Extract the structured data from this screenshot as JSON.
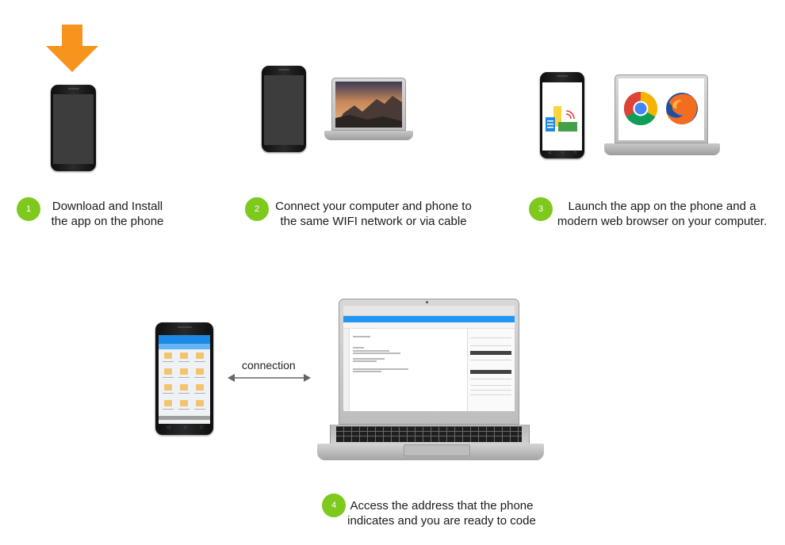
{
  "steps": [
    {
      "number": "1",
      "line1": "Download and Install",
      "line2": "the app on the phone"
    },
    {
      "number": "2",
      "line1": "Connect your computer and phone to",
      "line2": "the same WIFI network or via cable"
    },
    {
      "number": "3",
      "line1": "Launch the app on the phone and a",
      "line2": "modern web browser on your computer."
    },
    {
      "number": "4",
      "line1": "Access the address that the phone",
      "line2": "indicates and you are ready to code"
    }
  ],
  "connection_label": "connection",
  "colors": {
    "badge": "#7dc91e",
    "download_arrow": "#f7941d",
    "ide_toolbar": "#2196f3",
    "app_bar": "#1e88e5"
  }
}
